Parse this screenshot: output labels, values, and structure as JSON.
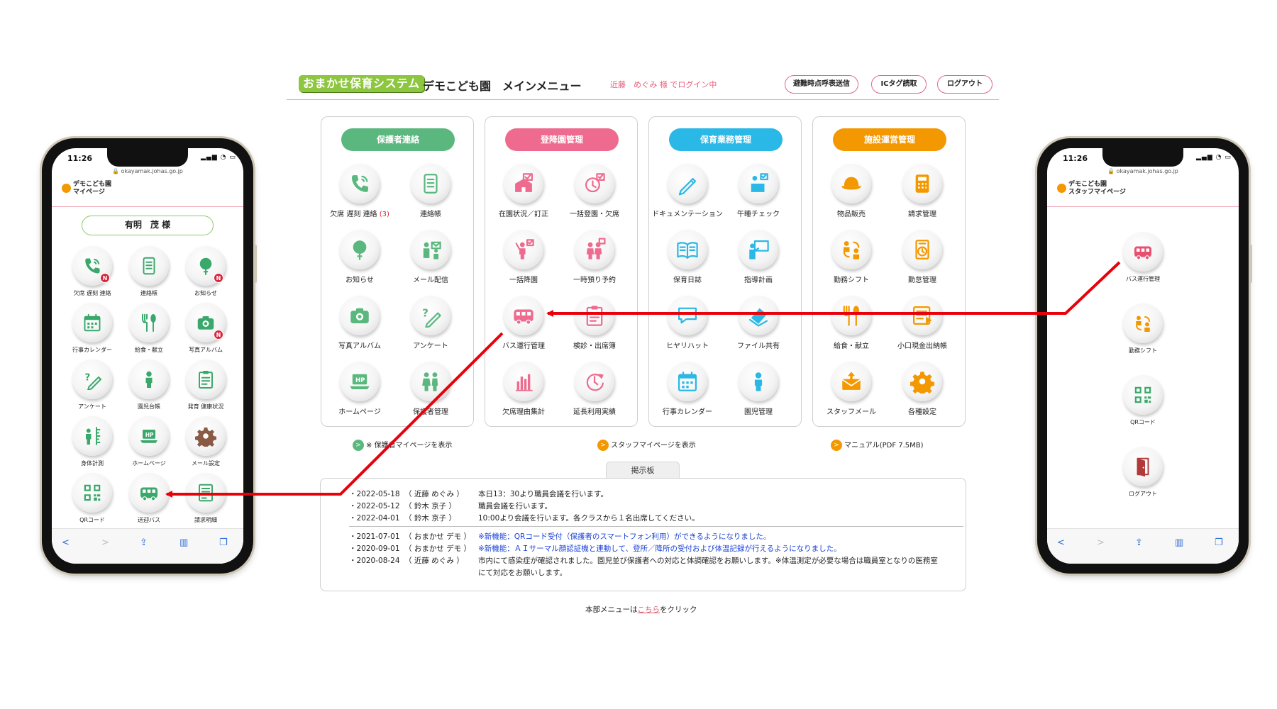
{
  "header": {
    "logo": "おまかせ保育システム",
    "title": "デモこども園　メインメニュー",
    "login_status": "近藤　めぐみ 様 でログイン中",
    "buttons": {
      "evac": "避難時点呼表送信",
      "ic": "ICタグ読取",
      "logout": "ログアウト"
    }
  },
  "colors": {
    "green": "#5ab87e",
    "pink": "#ee6a8e",
    "blue": "#2ab8e6",
    "orange": "#f39800",
    "accent_red": "#e8000a"
  },
  "panels": [
    {
      "title": "保護者連絡",
      "items": [
        {
          "label": "欠席 遅刻 連絡",
          "count": "(3)",
          "icon": "phone-icon"
        },
        {
          "label": "連絡帳",
          "icon": "notebook-icon"
        },
        {
          "label": "お知らせ",
          "icon": "balloon-icon"
        },
        {
          "label": "メール配信",
          "icon": "people-mail-icon"
        },
        {
          "label": "写真アルバム",
          "icon": "camera-icon"
        },
        {
          "label": "アンケート",
          "icon": "survey-pencil-icon"
        },
        {
          "label": "ホームページ",
          "icon": "hp-laptop-icon"
        },
        {
          "label": "保護者管理",
          "icon": "guardians-icon"
        }
      ]
    },
    {
      "title": "登降園管理",
      "items": [
        {
          "label": "在園状況／訂正",
          "icon": "school-icon"
        },
        {
          "label": "一括登園・欠席",
          "icon": "clock-check-icon"
        },
        {
          "label": "一括降園",
          "icon": "person-raise-icon"
        },
        {
          "label": "一時預り予約",
          "icon": "pair-people-icon"
        },
        {
          "label": "バス運行管理",
          "icon": "bus-icon"
        },
        {
          "label": "検診・出席簿",
          "icon": "clipboard-icon"
        },
        {
          "label": "欠席理由集計",
          "icon": "bar-chart-icon"
        },
        {
          "label": "延長利用実績",
          "icon": "clock-arrow-icon"
        }
      ]
    },
    {
      "title": "保育業務管理",
      "items": [
        {
          "label": "ドキュメンテーション",
          "icon": "pencil-icon"
        },
        {
          "label": "午睡チェック",
          "icon": "sleep-check-icon"
        },
        {
          "label": "保育日誌",
          "icon": "open-book-icon"
        },
        {
          "label": "指導計画",
          "icon": "teacher-board-icon"
        },
        {
          "label": "ヒヤリハット",
          "icon": "speech-icon"
        },
        {
          "label": "ファイル共有",
          "icon": "files-icon"
        },
        {
          "label": "行事カレンダー",
          "icon": "calendar-icon"
        },
        {
          "label": "園児管理",
          "icon": "child-icon"
        }
      ]
    },
    {
      "title": "施設運営管理",
      "items": [
        {
          "label": "物品販売",
          "icon": "hat-icon"
        },
        {
          "label": "請求管理",
          "icon": "calculator-icon"
        },
        {
          "label": "勤務シフト",
          "icon": "shift-icon"
        },
        {
          "label": "勤怠管理",
          "icon": "timecard-icon"
        },
        {
          "label": "給食・献立",
          "icon": "fork-spoon-icon"
        },
        {
          "label": "小口現金出納帳",
          "icon": "ledger-icon"
        },
        {
          "label": "スタッフメール",
          "icon": "mail-icon"
        },
        {
          "label": "各種設定",
          "icon": "gear-icon"
        }
      ]
    }
  ],
  "panel_links": {
    "guardian": "※ 保護者マイページを表示",
    "staff": "スタッフマイページを表示",
    "manual": "マニュアル(PDF 7.5MB)"
  },
  "board": {
    "tab": "掲示板",
    "notices": [
      {
        "date": "・2022-05-18",
        "author": "（ 近藤 めぐみ ）",
        "msg": "本日13：30より職員会議を行います。",
        "style": ""
      },
      {
        "date": "・2022-05-12",
        "author": "（ 鈴木 京子 ）",
        "msg": "職員会議を行います。",
        "style": ""
      },
      {
        "date": "・2022-04-01",
        "author": "（ 鈴木 京子 ）",
        "msg": "10:00より会議を行います。各クラスから１名出席してください。",
        "style": ""
      },
      {
        "date": "・2021-07-01",
        "author": "（ おまかせ デモ ）",
        "msg": "※新機能：QRコード受付（保護者のスマートフォン利用）ができるようになりました。",
        "style": "blue"
      },
      {
        "date": "・2020-09-01",
        "author": "（ おまかせ デモ ）",
        "msg": "※新機能：ＡＩサーマル顔認証機と連動して、登所／降所の受付および体温記録が行えるようになりました。",
        "style": "blue"
      },
      {
        "date": "・2020-08-24",
        "author": "（ 近藤 めぐみ ）",
        "msg": "市内にて感染症が確認されました。園児並び保護者への対応と体調確認をお願いします。※体温測定が必要な場合は職員室となりの医務室",
        "style": ""
      }
    ],
    "continuation": "にて対応をお願いします。"
  },
  "footer": {
    "prefix": "本部メニューは",
    "link": "こちら",
    "suffix": "をクリック"
  },
  "phone_left": {
    "time": "11:26",
    "url": "🔒 okayamak.johas.go.jp",
    "title": "デモこども園\nマイページ",
    "user": "有明　茂 様",
    "items": [
      {
        "label": "欠席 遅刻 連絡",
        "icon": "phone-icon",
        "badge": "N"
      },
      {
        "label": "連絡帳",
        "icon": "notebook-icon",
        "badge": ""
      },
      {
        "label": "お知らせ",
        "icon": "balloon-icon",
        "badge": "N"
      },
      {
        "label": "行事カレンダー",
        "icon": "calendar-icon",
        "badge": ""
      },
      {
        "label": "給食・献立",
        "icon": "fork-spoon-icon",
        "badge": ""
      },
      {
        "label": "写真アルバム",
        "icon": "camera-icon",
        "badge": "N"
      },
      {
        "label": "アンケート",
        "icon": "survey-pencil-icon",
        "badge": ""
      },
      {
        "label": "園児台帳",
        "icon": "child-icon",
        "badge": ""
      },
      {
        "label": "発育 健康状況",
        "icon": "clipboard-icon",
        "badge": ""
      },
      {
        "label": "身体計測",
        "icon": "height-icon",
        "badge": ""
      },
      {
        "label": "ホームページ",
        "icon": "hp-laptop-icon",
        "badge": ""
      },
      {
        "label": "メール設定",
        "icon": "gear-icon",
        "badge": ""
      },
      {
        "label": "QRコード",
        "icon": "qr-icon",
        "badge": ""
      },
      {
        "label": "送迎バス",
        "icon": "bus-icon",
        "badge": ""
      },
      {
        "label": "請求明細",
        "icon": "invoice-icon",
        "badge": ""
      }
    ]
  },
  "phone_right": {
    "time": "11:26",
    "url": "🔒 okayamak.johas.go.jp",
    "title": "デモこども園\nスタッフマイページ",
    "items": [
      {
        "label": "バス運行管理",
        "icon": "bus-icon"
      },
      {
        "label": "勤務シフト",
        "icon": "shift-icon"
      },
      {
        "label": "QRコード",
        "icon": "qr-icon"
      },
      {
        "label": "ログアウト",
        "icon": "door-icon"
      }
    ]
  }
}
